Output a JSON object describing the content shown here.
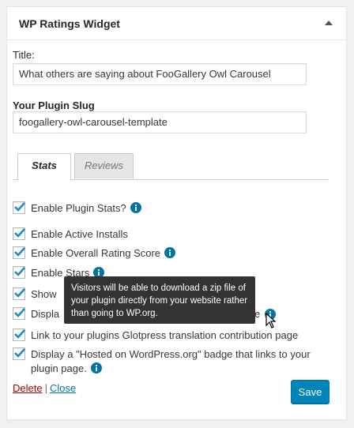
{
  "widget": {
    "title": "WP Ratings Widget"
  },
  "form": {
    "title_label": "Title:",
    "title_value": "What others are saying about FooGallery Owl Carousel",
    "slug_label": "Your Plugin Slug",
    "slug_value": "foogallery-owl-carousel-template"
  },
  "tabs": [
    {
      "label": "Stats",
      "active": true
    },
    {
      "label": "Reviews",
      "active": false
    }
  ],
  "options": [
    {
      "label": "Enable Plugin Stats?",
      "checked": true,
      "info": true
    },
    {
      "label": "Enable Active Installs",
      "checked": true,
      "info": false
    },
    {
      "label": "Enable Overall Rating Score",
      "checked": true,
      "info": true
    },
    {
      "label": "Enable Stars",
      "checked": true,
      "info": true
    },
    {
      "label": "Show",
      "checked": true,
      "info": false
    },
    {
      "label": "Displa",
      "label_tail": "e",
      "checked": true,
      "info": true
    },
    {
      "label": "Link to your plugins Glotpress translation contribution page",
      "checked": true,
      "info": false
    },
    {
      "label": "Display a \"Hosted on WordPress.org\" badge that links to your plugin page.",
      "checked": true,
      "info": true
    }
  ],
  "tooltip": {
    "text": "Visitors will be able to download a zip file of your plugin directly from your website rather than going to WP.org."
  },
  "footer": {
    "delete_label": "Delete",
    "separator": "|",
    "close_label": "Close",
    "save_label": "Save"
  },
  "colors": {
    "primary": "#0085ba",
    "info_icon": "#0073aa",
    "check": "#1e8cbe",
    "delete": "#a00"
  }
}
